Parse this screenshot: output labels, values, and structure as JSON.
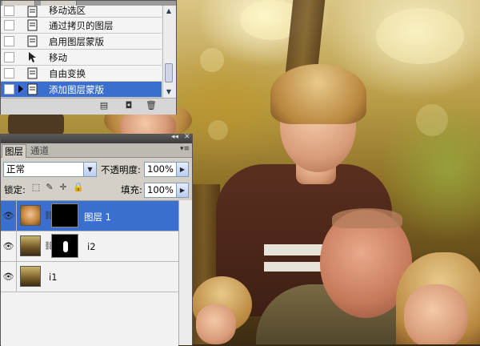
{
  "history_panel": {
    "items": [
      {
        "label": "移动选区",
        "icon": "history-state-icon"
      },
      {
        "label": "通过拷贝的图层",
        "icon": "history-state-icon"
      },
      {
        "label": "启用图层蒙版",
        "icon": "history-state-icon"
      },
      {
        "label": "移动",
        "icon": "move-tool-icon"
      },
      {
        "label": "自由变换",
        "icon": "history-state-icon"
      },
      {
        "label": "添加图层蒙版",
        "icon": "history-state-icon",
        "selected": true
      }
    ],
    "footer_icons": [
      "new-document-from-state-icon",
      "new-snapshot-icon",
      "delete-state-icon"
    ]
  },
  "layers_panel": {
    "tabs": [
      {
        "label": "图层",
        "active": true
      },
      {
        "label": "通道",
        "active": false
      }
    ],
    "blend_mode": "正常",
    "opacity_label": "不透明度:",
    "opacity_value": "100%",
    "lock_label": "锁定:",
    "fill_label": "填充:",
    "fill_value": "100%",
    "layers": [
      {
        "name": "图层 1",
        "visible": true,
        "selected": true,
        "has_mask": true
      },
      {
        "name": "i2",
        "visible": true,
        "selected": false,
        "has_mask": true
      },
      {
        "name": "i1",
        "visible": true,
        "selected": false,
        "has_mask": false
      }
    ]
  },
  "colors": {
    "selection": "#3a6fcf",
    "panel_bg": "#d4d0c8",
    "panel_header": "#3c3c3c"
  }
}
